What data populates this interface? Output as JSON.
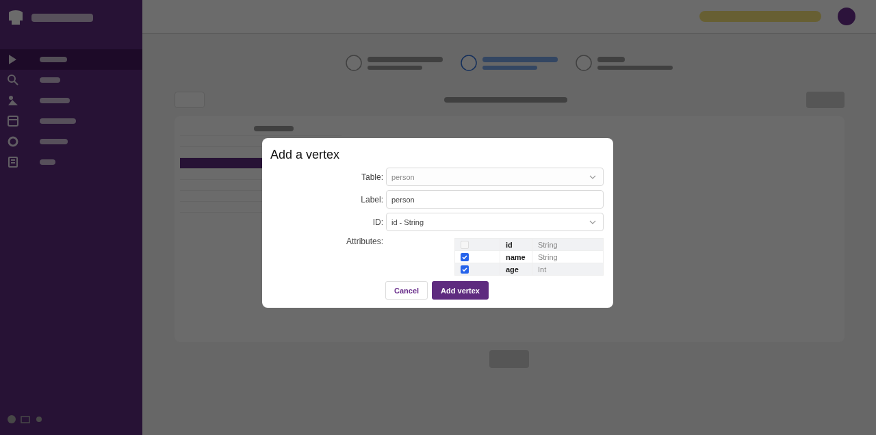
{
  "sidebar": {
    "items": [
      {
        "selected": true
      },
      {
        "selected": false
      },
      {
        "selected": false
      },
      {
        "selected": false
      },
      {
        "selected": false
      },
      {
        "selected": false
      }
    ]
  },
  "steps": [
    {
      "selected": false
    },
    {
      "selected": true
    },
    {
      "selected": false
    }
  ],
  "dialog": {
    "title": "Add a vertex",
    "fields": [
      {
        "label": "Table:",
        "kind": "select",
        "value": "person",
        "disabled": true
      },
      {
        "label": "Label:",
        "kind": "input",
        "value": "person",
        "disabled": false
      },
      {
        "label": "ID:",
        "kind": "select",
        "value": "id - String",
        "disabled": false
      }
    ],
    "attributes_label": "Attributes:",
    "attributes": [
      {
        "name": "id",
        "type": "String",
        "checked": false
      },
      {
        "name": "name",
        "type": "String",
        "checked": true
      },
      {
        "name": "age",
        "type": "Int",
        "checked": true
      }
    ],
    "cancel": "Cancel",
    "submit": "Add vertex"
  }
}
